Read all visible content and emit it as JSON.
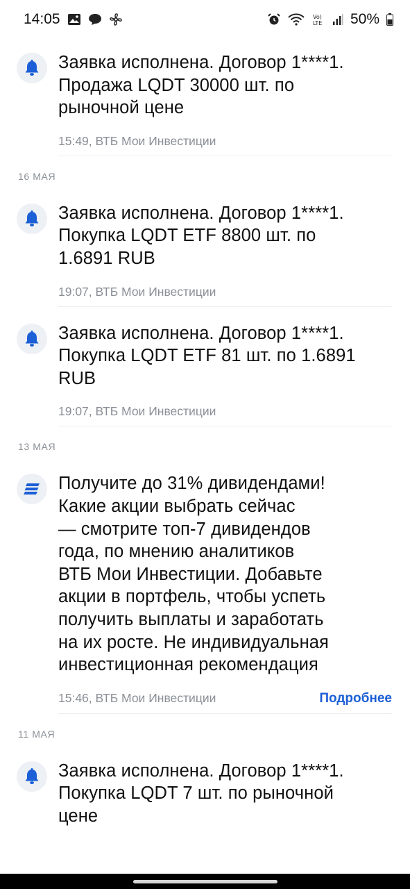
{
  "status_bar": {
    "time": "14:05",
    "battery": "50%",
    "network_label": "Vo) LTE"
  },
  "sections": [
    {
      "date": "",
      "items": [
        {
          "icon": "bell-icon",
          "text": "Заявка исполнена. Договор 1****1.\nПродажа LQDT 30000 шт. по\nрыночной цене",
          "meta": "15:49, ВТБ Мои Инвестиции"
        }
      ]
    },
    {
      "date": "16 МАЯ",
      "items": [
        {
          "icon": "bell-icon",
          "text": "Заявка исполнена. Договор 1****1.\nПокупка LQDT ETF 8800 шт. по\n1.6891 RUB",
          "meta": "19:07, ВТБ Мои Инвестиции"
        },
        {
          "icon": "bell-icon",
          "text": "Заявка исполнена. Договор 1****1.\nПокупка LQDT ETF 81 шт. по 1.6891\nRUB",
          "meta": "19:07, ВТБ Мои Инвестиции"
        }
      ]
    },
    {
      "date": "13 МАЯ",
      "items": [
        {
          "icon": "vtb-logo-icon",
          "text": "Получите до 31% дивидендами!\nКакие акции выбрать сейчас\n— смотрите топ-7 дивидендов\nгода, по мнению аналитиков\nВТБ Мои Инвестиции. Добавьте\nакции в портфель, чтобы успеть\nполучить выплаты и заработать\nна их росте. Не индивидуальная\nинвестиционная рекомендация",
          "meta": "15:46, ВТБ Мои Инвестиции",
          "link": "Подробнее"
        }
      ]
    },
    {
      "date": "11 МАЯ",
      "items": [
        {
          "icon": "bell-icon",
          "text": "Заявка исполнена. Договор 1****1.\nПокупка LQDT 7 шт. по рыночной\nцене",
          "meta": ""
        }
      ]
    }
  ],
  "colors": {
    "accent": "#1c5fd6",
    "icon_bg": "#edf0f4",
    "muted": "#8a8f96"
  }
}
